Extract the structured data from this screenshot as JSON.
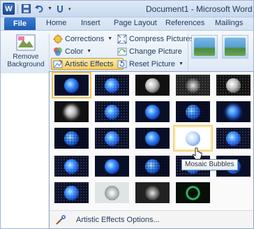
{
  "window": {
    "title": "Document1 - Microsoft Word",
    "app_icon_letter": "W"
  },
  "tabs": {
    "file": "File",
    "items": [
      "Home",
      "Insert",
      "Page Layout",
      "References",
      "Mailings"
    ]
  },
  "ribbon": {
    "remove_background_line1": "Remove",
    "remove_background_line2": "Background",
    "corrections": "Corrections",
    "color": "Color",
    "artistic_effects": "Artistic Effects",
    "compress_pictures": "Compress Pictures",
    "change_picture": "Change Picture",
    "reset_picture": "Reset Picture"
  },
  "gallery": {
    "tooltip": "Mosaic Bubbles",
    "footer": "Artistic Effects Options..."
  },
  "colors": {
    "accent": "#f2c34c",
    "file_tab": "#2a6cc6",
    "ribbon_text": "#1e395b"
  }
}
